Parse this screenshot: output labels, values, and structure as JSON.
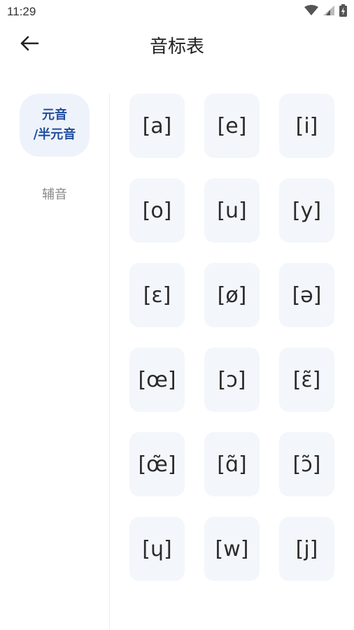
{
  "status": {
    "time": "11:29"
  },
  "header": {
    "title": "音标表",
    "back_icon": "arrow-left-icon"
  },
  "nav": {
    "items": [
      {
        "line1": "元音",
        "line2": "/半元音",
        "active": true
      },
      {
        "label": "辅音",
        "active": false
      }
    ]
  },
  "symbols": [
    "[a]",
    "[e]",
    "[i]",
    "[o]",
    "[u]",
    "[y]",
    "[ɛ]",
    "[ø]",
    "[ə]",
    "[œ]",
    "[ɔ]",
    "[ɛ̃]",
    "[œ̃]",
    "[ɑ̃]",
    "[ɔ̃]",
    "[ɥ]",
    "[w]",
    "[j]"
  ],
  "colors": {
    "accent": "#1f4d9e",
    "tile_bg": "#f3f6fb",
    "active_nav_bg": "#eef2fa"
  }
}
